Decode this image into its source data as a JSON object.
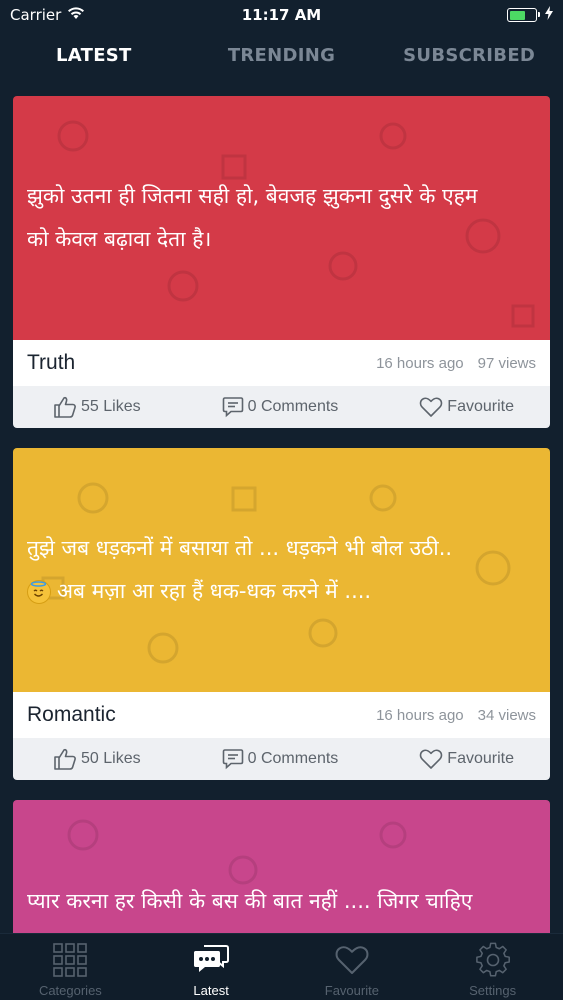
{
  "status_bar": {
    "carrier": "Carrier",
    "time": "11:17 AM",
    "battery_level": 0.6
  },
  "top_tabs": [
    {
      "label": "LATEST",
      "active": true
    },
    {
      "label": "TRENDING",
      "active": false
    },
    {
      "label": "SUBSCRIBED",
      "active": false
    }
  ],
  "cards": [
    {
      "bg_color": "#d43a48",
      "quote_line1": "झुको उतना ही जितना सही हो, बेवजह झुकना दुसरे के एहम",
      "quote_line2": "को केवल बढ़ावा देता है।",
      "category": "Truth",
      "time_ago": "16 hours ago",
      "views": "97 views",
      "likes": "55 Likes",
      "comments": "0 Comments",
      "favourite": "Favourite"
    },
    {
      "bg_color": "#ebb733",
      "quote_line1": "तुझे जब धड़कनों में बसाया तो ... धड़कने भी बोल उठी..",
      "quote_line2": "अब मज़ा आ रहा हैं धक-धक करने में ....",
      "emoji": "😇",
      "category": "Romantic",
      "time_ago": "16 hours ago",
      "views": "34 views",
      "likes": "50 Likes",
      "comments": "0 Comments",
      "favourite": "Favourite"
    },
    {
      "bg_color": "#c8468c",
      "quote_line1": "प्यार करना हर किसी के बस की बात नहीं .... जिगर चाहिए"
    }
  ],
  "bottom_tabs": [
    {
      "label": "Categories",
      "icon": "grid-icon",
      "active": false
    },
    {
      "label": "Latest",
      "icon": "chat-bubbles-icon",
      "active": true
    },
    {
      "label": "Favourite",
      "icon": "heart-icon",
      "active": false
    },
    {
      "label": "Settings",
      "icon": "gear-icon",
      "active": false
    }
  ]
}
